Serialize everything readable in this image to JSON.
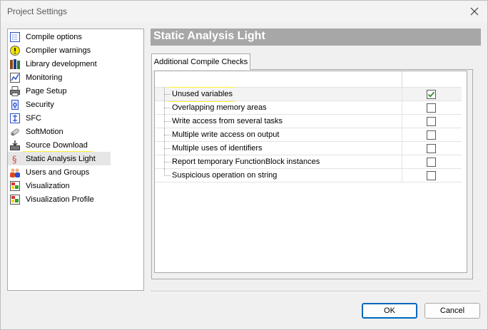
{
  "window": {
    "title": "Project Settings",
    "close_icon": "close-icon"
  },
  "sidebar": {
    "items": [
      {
        "label": "Compile options",
        "icon": "compile-options-icon",
        "color": "#2a4fd1"
      },
      {
        "label": "Compiler warnings",
        "icon": "warning-icon",
        "color": "#f2e200"
      },
      {
        "label": "Library development",
        "icon": "library-icon",
        "color": "#8a4b17"
      },
      {
        "label": "Monitoring",
        "icon": "monitoring-icon",
        "color": "#2a4fd1"
      },
      {
        "label": "Page Setup",
        "icon": "printer-icon",
        "color": "#7a7a7a"
      },
      {
        "label": "Security",
        "icon": "security-icon",
        "color": "#2a4fd1"
      },
      {
        "label": "SFC",
        "icon": "sfc-icon",
        "color": "#2a4fd1"
      },
      {
        "label": "SoftMotion",
        "icon": "softmotion-icon",
        "color": "#8a8a8a"
      },
      {
        "label": "Source Download",
        "icon": "source-download-icon",
        "color": "#3a3a3a"
      },
      {
        "label": "Static Analysis Light",
        "icon": "static-analysis-icon",
        "color": "#d33b3b",
        "selected": true
      },
      {
        "label": "Users and Groups",
        "icon": "users-icon",
        "color": "#d84a1f"
      },
      {
        "label": "Visualization",
        "icon": "visualization-icon",
        "color": "#2aa02a"
      },
      {
        "label": "Visualization Profile",
        "icon": "visualization-profile-icon",
        "color": "#2aa02a"
      }
    ]
  },
  "main": {
    "heading": "Static Analysis Light",
    "tab_label": "Additional Compile Checks",
    "checks": [
      {
        "label": "Unused variables",
        "checked": true
      },
      {
        "label": "Overlapping memory areas",
        "checked": false
      },
      {
        "label": "Write access from several tasks",
        "checked": false
      },
      {
        "label": "Multiple write access on output",
        "checked": false
      },
      {
        "label": "Multiple uses of identifiers",
        "checked": false
      },
      {
        "label": "Report temporary FunctionBlock instances",
        "checked": false
      },
      {
        "label": "Suspicious operation on string",
        "checked": false
      }
    ]
  },
  "buttons": {
    "ok": "OK",
    "cancel": "Cancel"
  },
  "colors": {
    "highlight": "#fef22f",
    "heading_bg": "#a7a7a7",
    "check_green": "#2e8b2e",
    "accent": "#0067c0"
  }
}
